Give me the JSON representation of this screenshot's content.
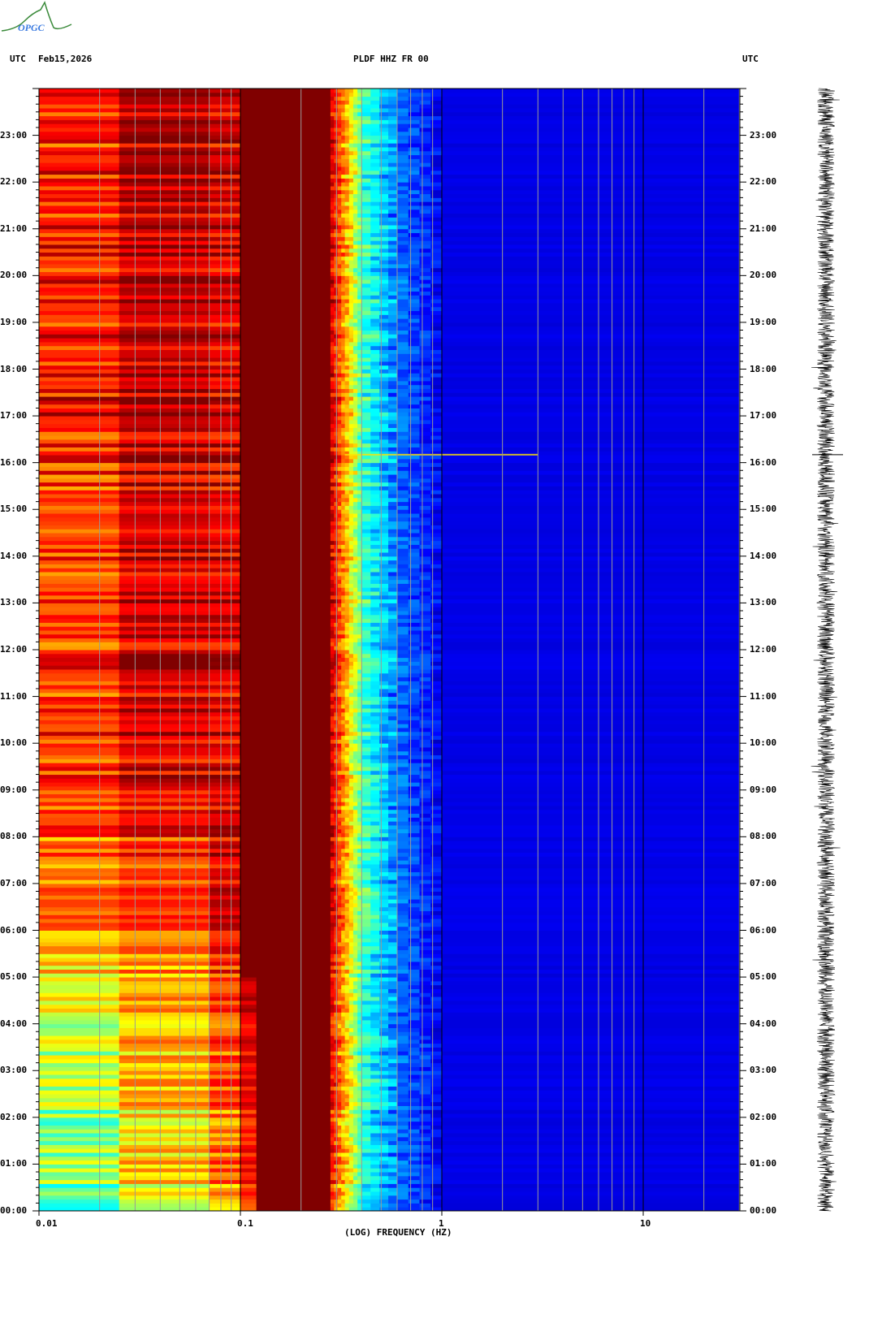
{
  "header": {
    "tz_left": "UTC",
    "date": "Feb15,2026",
    "title": "PLDF HHZ FR 00",
    "tz_right": "UTC",
    "logo_text": "OPGC"
  },
  "chart_data": {
    "type": "heatmap",
    "title": "PLDF HHZ FR 00",
    "xlabel": "(LOG) FREQUENCY (HZ)",
    "xscale": "log",
    "xlim": [
      0.01,
      30
    ],
    "x_ticks": [
      "0.01",
      "0.1",
      "1",
      "10"
    ],
    "x_tick_values": [
      0.01,
      0.1,
      1,
      10
    ],
    "ylabel": "UTC",
    "ylim_hours": [
      0,
      24
    ],
    "y_ticks": [
      "00:00",
      "01:00",
      "02:00",
      "03:00",
      "04:00",
      "05:00",
      "06:00",
      "07:00",
      "08:00",
      "09:00",
      "10:00",
      "11:00",
      "12:00",
      "13:00",
      "14:00",
      "15:00",
      "16:00",
      "17:00",
      "18:00",
      "19:00",
      "20:00",
      "21:00",
      "22:00",
      "23:00"
    ],
    "colormap": "jet",
    "freq_bands": [
      0.01,
      0.025,
      0.07,
      0.1,
      0.12,
      0.28,
      0.33,
      0.4,
      0.6,
      1.0,
      30
    ],
    "intensity_by_hour": [
      [
        0.5,
        0.65,
        0.75,
        0.85,
        1.0,
        0.85,
        0.65,
        0.4,
        0.22,
        0.1
      ],
      [
        0.5,
        0.65,
        0.75,
        0.85,
        1.0,
        0.85,
        0.65,
        0.4,
        0.22,
        0.1
      ],
      [
        0.52,
        0.66,
        0.76,
        0.86,
        1.0,
        0.86,
        0.66,
        0.4,
        0.22,
        0.1
      ],
      [
        0.55,
        0.68,
        0.78,
        0.88,
        1.0,
        0.86,
        0.66,
        0.4,
        0.22,
        0.1
      ],
      [
        0.6,
        0.7,
        0.8,
        0.92,
        1.0,
        0.87,
        0.67,
        0.4,
        0.22,
        0.1
      ],
      [
        0.68,
        0.74,
        0.85,
        1.0,
        1.0,
        0.88,
        0.68,
        0.42,
        0.22,
        0.1
      ],
      [
        0.72,
        0.76,
        0.86,
        1.0,
        1.0,
        0.88,
        0.68,
        0.42,
        0.22,
        0.1
      ],
      [
        0.74,
        0.8,
        0.88,
        1.0,
        1.0,
        0.88,
        0.68,
        0.42,
        0.22,
        0.1
      ],
      [
        0.8,
        0.86,
        0.9,
        1.0,
        1.0,
        0.89,
        0.69,
        0.42,
        0.22,
        0.1
      ],
      [
        0.82,
        0.9,
        0.9,
        1.0,
        1.0,
        0.9,
        0.7,
        0.42,
        0.22,
        0.1
      ],
      [
        0.84,
        0.92,
        0.9,
        1.0,
        1.0,
        0.9,
        0.7,
        0.42,
        0.22,
        0.1
      ],
      [
        0.82,
        0.92,
        0.9,
        1.0,
        1.0,
        0.9,
        0.7,
        0.42,
        0.22,
        0.1
      ],
      [
        0.8,
        0.9,
        0.9,
        1.0,
        1.0,
        0.9,
        0.7,
        0.42,
        0.22,
        0.1
      ],
      [
        0.8,
        0.9,
        0.9,
        1.0,
        1.0,
        0.9,
        0.7,
        0.42,
        0.22,
        0.1
      ],
      [
        0.82,
        0.92,
        0.9,
        1.0,
        1.0,
        0.9,
        0.7,
        0.42,
        0.22,
        0.1
      ],
      [
        0.82,
        0.92,
        0.9,
        1.0,
        1.0,
        0.9,
        0.7,
        0.42,
        0.22,
        0.1
      ],
      [
        0.84,
        0.93,
        0.91,
        1.0,
        1.0,
        0.9,
        0.7,
        0.42,
        0.22,
        0.1
      ],
      [
        0.88,
        0.96,
        0.92,
        1.0,
        1.0,
        0.9,
        0.7,
        0.42,
        0.22,
        0.1
      ],
      [
        0.86,
        0.94,
        0.91,
        1.0,
        1.0,
        0.9,
        0.7,
        0.42,
        0.22,
        0.1
      ],
      [
        0.84,
        0.93,
        0.91,
        1.0,
        1.0,
        0.9,
        0.7,
        0.42,
        0.22,
        0.1
      ],
      [
        0.86,
        0.94,
        0.91,
        1.0,
        1.0,
        0.9,
        0.7,
        0.42,
        0.22,
        0.1
      ],
      [
        0.85,
        0.94,
        0.91,
        1.0,
        1.0,
        0.9,
        0.7,
        0.42,
        0.22,
        0.1
      ],
      [
        0.84,
        0.95,
        0.91,
        1.0,
        1.0,
        0.9,
        0.7,
        0.42,
        0.22,
        0.1
      ],
      [
        0.85,
        0.95,
        0.91,
        1.0,
        1.0,
        0.9,
        0.7,
        0.42,
        0.22,
        0.1
      ]
    ],
    "events": [
      {
        "time_hours": 16.17,
        "freq_range": [
          0.33,
          3.0
        ],
        "intensity": 0.65
      }
    ]
  }
}
